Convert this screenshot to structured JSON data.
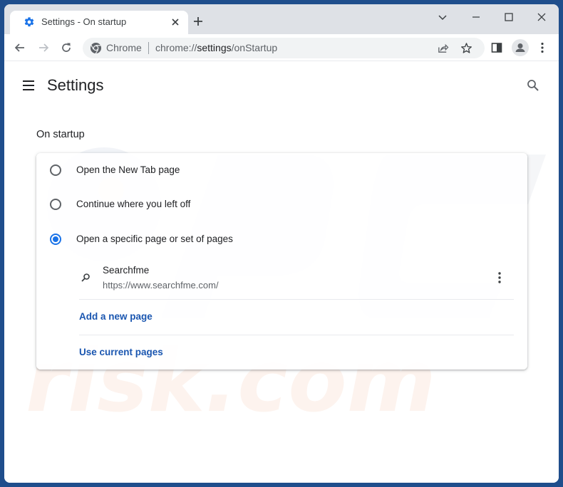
{
  "browser": {
    "tab": {
      "title": "Settings - On startup",
      "favicon": "gear-icon"
    },
    "window_controls": [
      "tab-search-icon",
      "minimize-icon",
      "maximize-icon",
      "close-icon"
    ],
    "omnibox": {
      "chip_label": "Chrome",
      "url_prefix": "chrome://",
      "url_host": "settings",
      "url_path": "/onStartup"
    },
    "toolbar_icons": [
      "share-icon",
      "bookmark-star-icon",
      "side-panel-icon",
      "profile-avatar-icon",
      "kebab-menu-icon"
    ]
  },
  "page": {
    "title": "Settings",
    "section_title": "On startup",
    "options": [
      {
        "label": "Open the New Tab page",
        "checked": false
      },
      {
        "label": "Continue where you left off",
        "checked": false
      },
      {
        "label": "Open a specific page or set of pages",
        "checked": true
      }
    ],
    "startup_pages": [
      {
        "name": "Searchfme",
        "url": "https://www.searchfme.com/"
      }
    ],
    "add_page_label": "Add a new page",
    "use_current_label": "Use current pages"
  },
  "colors": {
    "accent": "#1a73e8",
    "link": "#1a56b0",
    "window_border": "#1f4e8c",
    "titlebar": "#dee1e6"
  }
}
